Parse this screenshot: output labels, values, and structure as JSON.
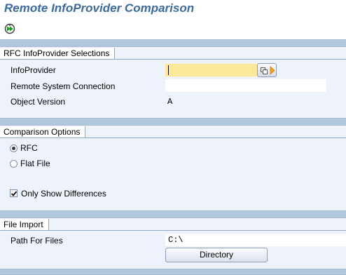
{
  "window": {
    "title": "Remote InfoProvider Comparison"
  },
  "toolbar": {
    "execute_icon": "execute-icon"
  },
  "sections": {
    "rfc": {
      "title": "RFC InfoProvider Selections",
      "infoprovider": {
        "label": "InfoProvider",
        "value": "",
        "valuehelp_icon": "value-help-icon"
      },
      "remote_connection": {
        "label": "Remote System Connection",
        "value": ""
      },
      "object_version": {
        "label": "Object Version",
        "value": "A"
      }
    },
    "comparison": {
      "title": "Comparison Options",
      "rfc_label": "RFC",
      "rfc_selected": true,
      "flatfile_label": "Flat File",
      "flatfile_selected": false,
      "only_diff_label": "Only Show Differences",
      "only_diff_checked": true
    },
    "file_import": {
      "title": "File Import",
      "path_label": "Path For Files",
      "path_value": "C:\\",
      "directory_button": "Directory"
    }
  },
  "colors": {
    "title": "#3d6a9c",
    "section_bar": "#b1c8dc",
    "background": "#eef3fb",
    "required_field": "#fbe899"
  }
}
